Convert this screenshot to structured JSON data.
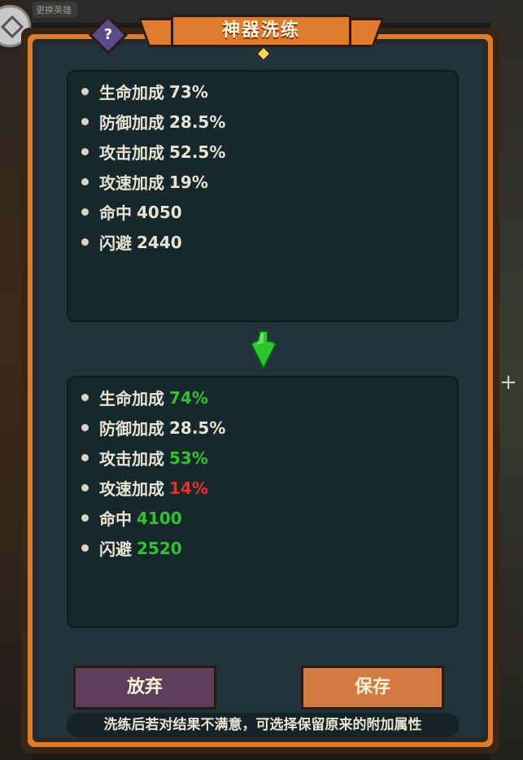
{
  "background": {
    "top_chip": "更换英雄"
  },
  "dialog": {
    "title": "神器洗练",
    "help_symbol": "?"
  },
  "before": {
    "stats": [
      {
        "name": "生命加成",
        "value": "73%"
      },
      {
        "name": "防御加成",
        "value": "28.5%"
      },
      {
        "name": "攻击加成",
        "value": "52.5%"
      },
      {
        "name": "攻速加成",
        "value": "19%"
      },
      {
        "name": "命中",
        "value": "4050"
      },
      {
        "name": "闪避",
        "value": "2440"
      }
    ]
  },
  "after": {
    "stats": [
      {
        "name": "生命加成",
        "value": "74%",
        "change": "up"
      },
      {
        "name": "防御加成",
        "value": "28.5%",
        "change": "same"
      },
      {
        "name": "攻击加成",
        "value": "53%",
        "change": "up"
      },
      {
        "name": "攻速加成",
        "value": "14%",
        "change": "down"
      },
      {
        "name": "命中",
        "value": "4100",
        "change": "up"
      },
      {
        "name": "闪避",
        "value": "2520",
        "change": "up"
      }
    ]
  },
  "buttons": {
    "give_up": "放弃",
    "save": "保存"
  },
  "hint": "洗练后若对结果不满意，可选择保留原来的附加属性",
  "colors": {
    "increase": "#2fc42f",
    "decrease": "#e8312a",
    "frame": "#e07a2c",
    "arrow": "#2fc42f"
  },
  "icons": {
    "arrow": "down-arrow-icon",
    "help": "question-icon",
    "plus": "plus-icon"
  }
}
